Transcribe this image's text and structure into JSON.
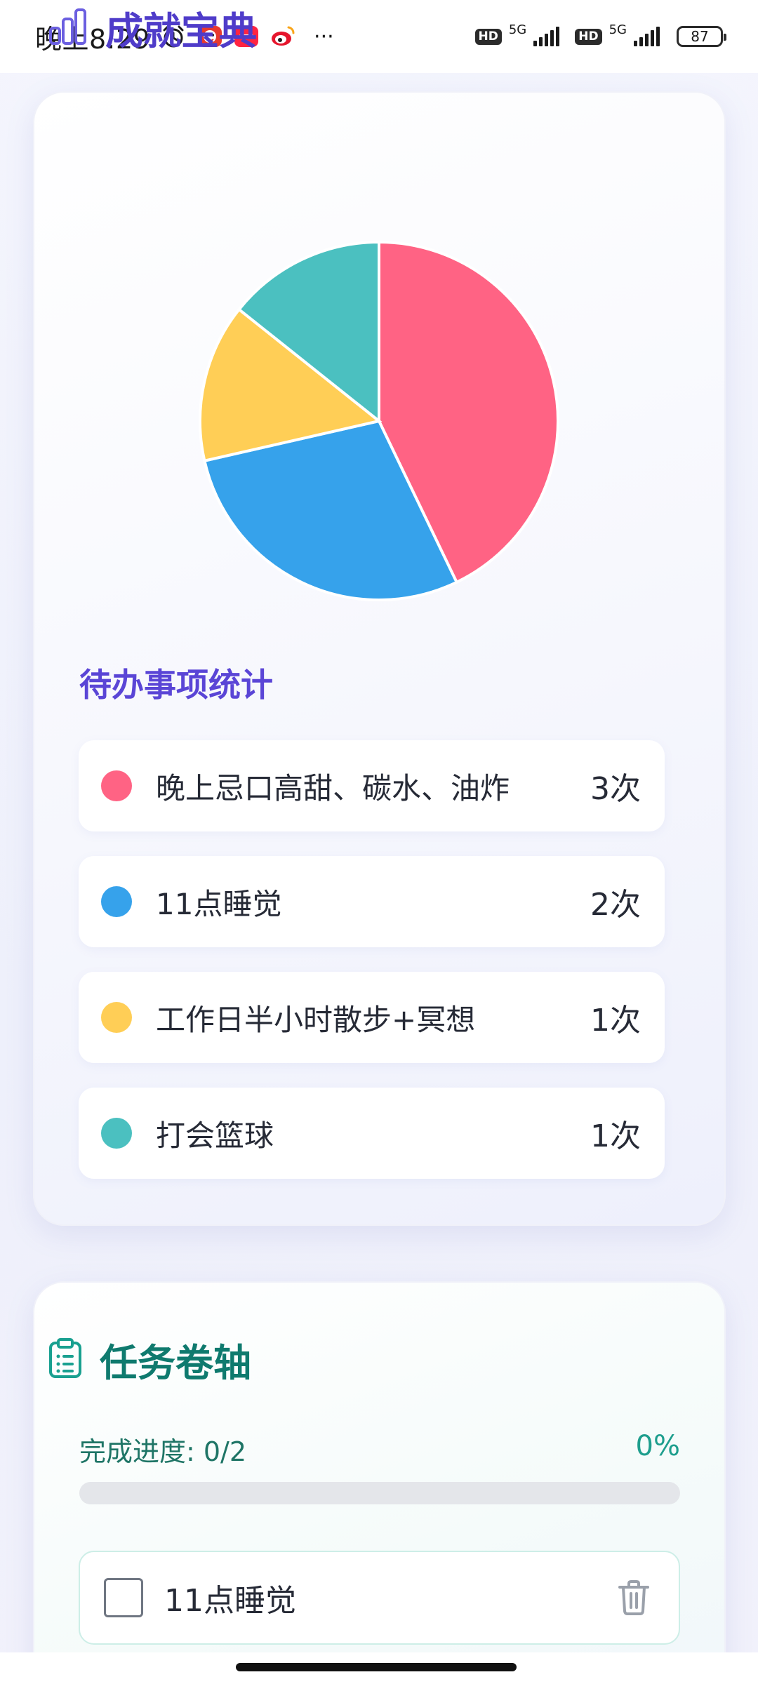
{
  "status_bar": {
    "time": "晚上8:29",
    "hd1": "HD",
    "net1": "5G",
    "hd2": "HD",
    "net2": "5G",
    "battery": "87",
    "more": "···"
  },
  "achievements": {
    "title": "成就宝典",
    "icon": "bar-chart-icon",
    "section_title": "待办事项统计",
    "items": [
      {
        "label": "晚上忌口高甜、碳水、油炸",
        "count": "3次",
        "value": 3,
        "color": "#ff6384"
      },
      {
        "label": "11点睡觉",
        "count": "2次",
        "value": 2,
        "color": "#36a2eb"
      },
      {
        "label": "工作日半小时散步+冥想",
        "count": "1次",
        "value": 1,
        "color": "#ffce56"
      },
      {
        "label": "打会篮球",
        "count": "1次",
        "value": 1,
        "color": "#4bc0c0"
      }
    ]
  },
  "chart_data": {
    "type": "pie",
    "categories": [
      "晚上忌口高甜、碳水、油炸",
      "11点睡觉",
      "工作日半小时散步+冥想",
      "打会篮球"
    ],
    "values": [
      3,
      2,
      1,
      1
    ],
    "colors": [
      "#ff6384",
      "#36a2eb",
      "#ffce56",
      "#4bc0c0"
    ]
  },
  "tasks": {
    "title": "任务卷轴",
    "icon": "clipboard-list-icon",
    "progress_label": "完成进度: 0/2",
    "progress_percent": "0%",
    "progress_fraction": 0,
    "items": [
      {
        "label": "11点睡觉",
        "checked": false
      }
    ]
  }
}
